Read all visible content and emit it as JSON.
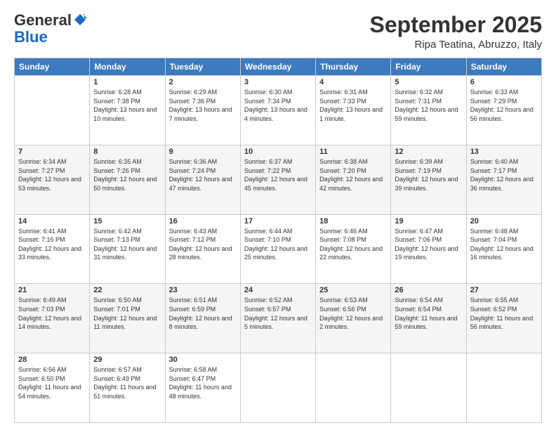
{
  "logo": {
    "general": "General",
    "blue": "Blue"
  },
  "title": "September 2025",
  "location": "Ripa Teatina, Abruzzo, Italy",
  "days_of_week": [
    "Sunday",
    "Monday",
    "Tuesday",
    "Wednesday",
    "Thursday",
    "Friday",
    "Saturday"
  ],
  "weeks": [
    [
      {
        "day": "",
        "sunrise": "",
        "sunset": "",
        "daylight": ""
      },
      {
        "day": "1",
        "sunrise": "Sunrise: 6:28 AM",
        "sunset": "Sunset: 7:38 PM",
        "daylight": "Daylight: 13 hours and 10 minutes."
      },
      {
        "day": "2",
        "sunrise": "Sunrise: 6:29 AM",
        "sunset": "Sunset: 7:36 PM",
        "daylight": "Daylight: 13 hours and 7 minutes."
      },
      {
        "day": "3",
        "sunrise": "Sunrise: 6:30 AM",
        "sunset": "Sunset: 7:34 PM",
        "daylight": "Daylight: 13 hours and 4 minutes."
      },
      {
        "day": "4",
        "sunrise": "Sunrise: 6:31 AM",
        "sunset": "Sunset: 7:33 PM",
        "daylight": "Daylight: 13 hours and 1 minute."
      },
      {
        "day": "5",
        "sunrise": "Sunrise: 6:32 AM",
        "sunset": "Sunset: 7:31 PM",
        "daylight": "Daylight: 12 hours and 59 minutes."
      },
      {
        "day": "6",
        "sunrise": "Sunrise: 6:33 AM",
        "sunset": "Sunset: 7:29 PM",
        "daylight": "Daylight: 12 hours and 56 minutes."
      }
    ],
    [
      {
        "day": "7",
        "sunrise": "Sunrise: 6:34 AM",
        "sunset": "Sunset: 7:27 PM",
        "daylight": "Daylight: 12 hours and 53 minutes."
      },
      {
        "day": "8",
        "sunrise": "Sunrise: 6:35 AM",
        "sunset": "Sunset: 7:26 PM",
        "daylight": "Daylight: 12 hours and 50 minutes."
      },
      {
        "day": "9",
        "sunrise": "Sunrise: 6:36 AM",
        "sunset": "Sunset: 7:24 PM",
        "daylight": "Daylight: 12 hours and 47 minutes."
      },
      {
        "day": "10",
        "sunrise": "Sunrise: 6:37 AM",
        "sunset": "Sunset: 7:22 PM",
        "daylight": "Daylight: 12 hours and 45 minutes."
      },
      {
        "day": "11",
        "sunrise": "Sunrise: 6:38 AM",
        "sunset": "Sunset: 7:20 PM",
        "daylight": "Daylight: 12 hours and 42 minutes."
      },
      {
        "day": "12",
        "sunrise": "Sunrise: 6:39 AM",
        "sunset": "Sunset: 7:19 PM",
        "daylight": "Daylight: 12 hours and 39 minutes."
      },
      {
        "day": "13",
        "sunrise": "Sunrise: 6:40 AM",
        "sunset": "Sunset: 7:17 PM",
        "daylight": "Daylight: 12 hours and 36 minutes."
      }
    ],
    [
      {
        "day": "14",
        "sunrise": "Sunrise: 6:41 AM",
        "sunset": "Sunset: 7:15 PM",
        "daylight": "Daylight: 12 hours and 33 minutes."
      },
      {
        "day": "15",
        "sunrise": "Sunrise: 6:42 AM",
        "sunset": "Sunset: 7:13 PM",
        "daylight": "Daylight: 12 hours and 31 minutes."
      },
      {
        "day": "16",
        "sunrise": "Sunrise: 6:43 AM",
        "sunset": "Sunset: 7:12 PM",
        "daylight": "Daylight: 12 hours and 28 minutes."
      },
      {
        "day": "17",
        "sunrise": "Sunrise: 6:44 AM",
        "sunset": "Sunset: 7:10 PM",
        "daylight": "Daylight: 12 hours and 25 minutes."
      },
      {
        "day": "18",
        "sunrise": "Sunrise: 6:46 AM",
        "sunset": "Sunset: 7:08 PM",
        "daylight": "Daylight: 12 hours and 22 minutes."
      },
      {
        "day": "19",
        "sunrise": "Sunrise: 6:47 AM",
        "sunset": "Sunset: 7:06 PM",
        "daylight": "Daylight: 12 hours and 19 minutes."
      },
      {
        "day": "20",
        "sunrise": "Sunrise: 6:48 AM",
        "sunset": "Sunset: 7:04 PM",
        "daylight": "Daylight: 12 hours and 16 minutes."
      }
    ],
    [
      {
        "day": "21",
        "sunrise": "Sunrise: 6:49 AM",
        "sunset": "Sunset: 7:03 PM",
        "daylight": "Daylight: 12 hours and 14 minutes."
      },
      {
        "day": "22",
        "sunrise": "Sunrise: 6:50 AM",
        "sunset": "Sunset: 7:01 PM",
        "daylight": "Daylight: 12 hours and 11 minutes."
      },
      {
        "day": "23",
        "sunrise": "Sunrise: 6:51 AM",
        "sunset": "Sunset: 6:59 PM",
        "daylight": "Daylight: 12 hours and 8 minutes."
      },
      {
        "day": "24",
        "sunrise": "Sunrise: 6:52 AM",
        "sunset": "Sunset: 6:57 PM",
        "daylight": "Daylight: 12 hours and 5 minutes."
      },
      {
        "day": "25",
        "sunrise": "Sunrise: 6:53 AM",
        "sunset": "Sunset: 6:56 PM",
        "daylight": "Daylight: 12 hours and 2 minutes."
      },
      {
        "day": "26",
        "sunrise": "Sunrise: 6:54 AM",
        "sunset": "Sunset: 6:54 PM",
        "daylight": "Daylight: 11 hours and 59 minutes."
      },
      {
        "day": "27",
        "sunrise": "Sunrise: 6:55 AM",
        "sunset": "Sunset: 6:52 PM",
        "daylight": "Daylight: 11 hours and 56 minutes."
      }
    ],
    [
      {
        "day": "28",
        "sunrise": "Sunrise: 6:56 AM",
        "sunset": "Sunset: 6:50 PM",
        "daylight": "Daylight: 11 hours and 54 minutes."
      },
      {
        "day": "29",
        "sunrise": "Sunrise: 6:57 AM",
        "sunset": "Sunset: 6:49 PM",
        "daylight": "Daylight: 11 hours and 51 minutes."
      },
      {
        "day": "30",
        "sunrise": "Sunrise: 6:58 AM",
        "sunset": "Sunset: 6:47 PM",
        "daylight": "Daylight: 11 hours and 48 minutes."
      },
      {
        "day": "",
        "sunrise": "",
        "sunset": "",
        "daylight": ""
      },
      {
        "day": "",
        "sunrise": "",
        "sunset": "",
        "daylight": ""
      },
      {
        "day": "",
        "sunrise": "",
        "sunset": "",
        "daylight": ""
      },
      {
        "day": "",
        "sunrise": "",
        "sunset": "",
        "daylight": ""
      }
    ]
  ]
}
